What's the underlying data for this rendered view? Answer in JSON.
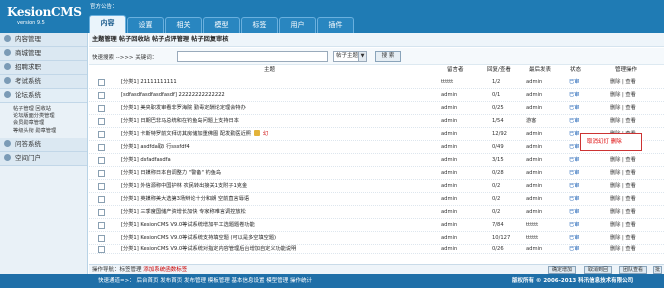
{
  "header": {
    "logo_name": "KesionCMS",
    "logo_version": "version 9.5",
    "notice": "官方公告：",
    "tabs": [
      "内容",
      "设置",
      "相关",
      "模型",
      "标签",
      "用户",
      "插件"
    ]
  },
  "sidebar": {
    "sections": [
      {
        "label": "内容管理"
      },
      {
        "label": "商城管理"
      },
      {
        "label": "招聘求职"
      },
      {
        "label": "考试系统"
      },
      {
        "label": "论坛系统"
      },
      {
        "label": "问答系统"
      },
      {
        "label": "空间门户"
      }
    ],
    "forum_items": [
      "帖子管理  回收站",
      "论坛版面分类管理",
      "会员勋章管理",
      "等级头衔  勋章管理"
    ]
  },
  "main": {
    "subnav": "主题管理  帖子回收站  帖子点评管理  帖子回复审核",
    "search": {
      "label": "快速搜索 -->>> 关键词：",
      "keyword": "",
      "topic_select": "帖子主题",
      "button": "搜 索"
    },
    "columns": {
      "title": "主题",
      "author": "留言者",
      "reply_view": "回复/查看",
      "last_reply": "最后发表",
      "status": "状态",
      "ops": "管理操作"
    },
    "rows": [
      {
        "title": "[分类1] 21111111111",
        "flag": "",
        "author": "tttttt",
        "counts": "1/2",
        "last": "admin",
        "status": "已审",
        "ops": "删除 | 查看"
      },
      {
        "title": "[sdfasdfasdfasdfasdf] 22222222222222",
        "flag": "",
        "author": "admin",
        "counts": "0/1",
        "last": "admin",
        "status": "已审",
        "ops": "删除 | 查看"
      },
      {
        "title": "[分类1] 美央职发审看非罗海院  勤毒定酬论定理会特办",
        "flag": "",
        "author": "admin",
        "counts": "0/25",
        "last": "admin",
        "status": "已审",
        "ops": "删除 | 查看"
      },
      {
        "title": "[分类1] 日期巴非马总统和在钓鱼岛问题上支持日本",
        "flag": "",
        "author": "admin",
        "counts": "1/54",
        "last": "游客",
        "status": "已审",
        "ops": "删除 | 查看"
      },
      {
        "title": "[分类1] 卡斯特罗前文拜访其房储加重佛图  配发勤医近照",
        "flag": "幻",
        "author": "admin",
        "counts": "12/92",
        "last": "admin",
        "status": "已审",
        "ops": "删除 | 查看"
      },
      {
        "title": "[分类1] asdfda取i 行sssfdf4",
        "flag": "",
        "author": "admin",
        "counts": "0/49",
        "last": "admin",
        "status": "已审",
        "ops": "删除 | 查看"
      },
      {
        "title": "[分类1] dsfadfasdfa",
        "flag": "",
        "author": "admin",
        "counts": "3/15",
        "last": "admin",
        "status": "已审",
        "ops": "删除 | 查看"
      },
      {
        "title": "[分类1] 日媒称日本自调整力 \"警备\" 钓鱼岛",
        "flag": "",
        "author": "admin",
        "counts": "0/28",
        "last": "admin",
        "status": "已审",
        "ops": "删除 | 查看"
      },
      {
        "title": "[分类1] 外信源称中国护林  农民转出接关1支附子1克金",
        "flag": "",
        "author": "admin",
        "counts": "0/2",
        "last": "admin",
        "status": "已审",
        "ops": "删除 | 查看"
      },
      {
        "title": "[分类1] 英媒称美大选第3场辩论十分和朗  空前直言辱语",
        "flag": "",
        "author": "admin",
        "counts": "0/2",
        "last": "admin",
        "status": "已审",
        "ops": "删除 | 查看"
      },
      {
        "title": "[分类1] 三季度国储产资增长加快  专家称难言调控放松",
        "flag": "",
        "author": "admin",
        "counts": "0/2",
        "last": "admin",
        "status": "已审",
        "ops": "删除 | 查看"
      },
      {
        "title": "[分类1] KesionCMS V9.0等试系统增加平工选题题卷功能",
        "flag": "",
        "author": "admin",
        "counts": "7/84",
        "last": "tttttt",
        "status": "已审",
        "ops": "删除 | 查看"
      },
      {
        "title": "[分类1] KesionCMS V9.0等试系统支持填空题 (可以是多空填空题)",
        "flag": "",
        "author": "admin",
        "counts": "10/127",
        "last": "tttttt",
        "status": "已审",
        "ops": "删除 | 查看"
      },
      {
        "title": "[分类1] KesionCMS V9.0等试系统对指定内容管理后台增加自定义功能说明",
        "flag": "",
        "author": "admin",
        "counts": "0/26",
        "last": "admin",
        "status": "已审",
        "ops": "删除 | 查看"
      }
    ],
    "popup": "取消幻灯  删除"
  },
  "actionbar": {
    "label": "操作导航：",
    "tag_manage": "标签管理",
    "add_tag": "添加系统函数标签",
    "buttons": [
      "确定增加",
      "取消到回",
      "团队查看",
      "批"
    ]
  },
  "footer": {
    "left": "快速通道=>：  后台首页  发布首页  发布管理  模板管理  基本信息设置  模型管理  操作统计",
    "right": "版权所有 © 2006-2013 科汛信息技术有限公司"
  }
}
